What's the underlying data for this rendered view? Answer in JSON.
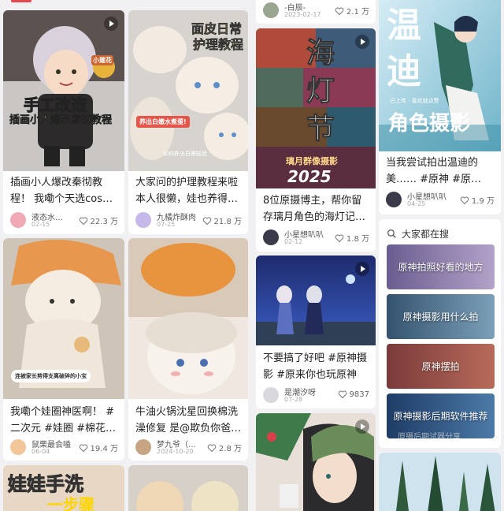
{
  "colors": {
    "accent": "#e5484d",
    "background": "#f1f1f3",
    "card": "#ffffff"
  },
  "cards": [
    {
      "id": "c1",
      "overlay_lines": [
        "手工改造",
        "插画小人爆改秦彻教程"
      ],
      "badge": "小建花",
      "title": "插画小人爆改秦彻教程！ 我嘞个天选cos…",
      "author": "液态水…",
      "date": "02-15",
      "likes": "22.3 万"
    },
    {
      "id": "c2",
      "overlay_lines": [
        "面皮日常",
        "护理教程"
      ],
      "sticker": "养出白嫩水煮蛋!",
      "caption_small": "如何养出白嫩娃脸",
      "title": "大家问的护理教程来啦 本人很懒，娃也养得…",
      "author": "九橘炸酥肉",
      "date": "07-25",
      "likes": "21.8 万"
    },
    {
      "id": "c3",
      "title_visible": "",
      "author": "-白辰-",
      "date": "2023-02-17",
      "likes": "2.1 万"
    },
    {
      "id": "c4",
      "overlay_lines": [
        "海",
        "灯",
        "节"
      ],
      "caption_small": "璃月群像摄影",
      "year": "2025",
      "title": "8位原摄博主，帮你留存璃月角色的海灯记…",
      "author": "小星想叭叭",
      "date": "02-12",
      "likes": "1.8 万"
    },
    {
      "id": "c5",
      "overlay_lines": [
        "温",
        "迪",
        "角色摄影"
      ],
      "caption_small": "已上传 · 喜欢就点赞",
      "title": "当我尝试拍出温迪的美…… #原神 #原…",
      "author": "小星想叭叭",
      "date": "04-25",
      "likes": "1.9 万"
    },
    {
      "id": "c6",
      "sticker": "连被家长剪得支离破碎的小宝",
      "title": "我嘞个娃圈神医啊！ #二次元 #娃圈 #棉花…",
      "author": "鼠栗最会嗑",
      "date": "06-04",
      "likes": "19.4 万"
    },
    {
      "id": "c7",
      "title": "牛油火锅沈星回换棉洗澡修复 是@欺负你爸…",
      "author": "梦九爷（…",
      "date": "2024-10-20",
      "likes": "2.8 万"
    },
    {
      "id": "c8",
      "title": "不要搞了好吧 #原神摄影 #原来你也玩原神 …",
      "author": "是潮汐呀",
      "date": "07-28",
      "likes": "9837"
    },
    {
      "id": "c9",
      "overlay_lines": [
        "娃娃手洗",
        "一步骤"
      ]
    },
    {
      "id": "c10"
    },
    {
      "id": "c11"
    },
    {
      "id": "c12"
    }
  ],
  "search": {
    "heading": "大家都在搜",
    "chips": [
      "原神拍照好看的地方",
      "原神摄影用什么拍",
      "原神摆拍",
      "原神摄影后期软件推荐"
    ],
    "chip_caption": "原摄后期试器分享"
  }
}
